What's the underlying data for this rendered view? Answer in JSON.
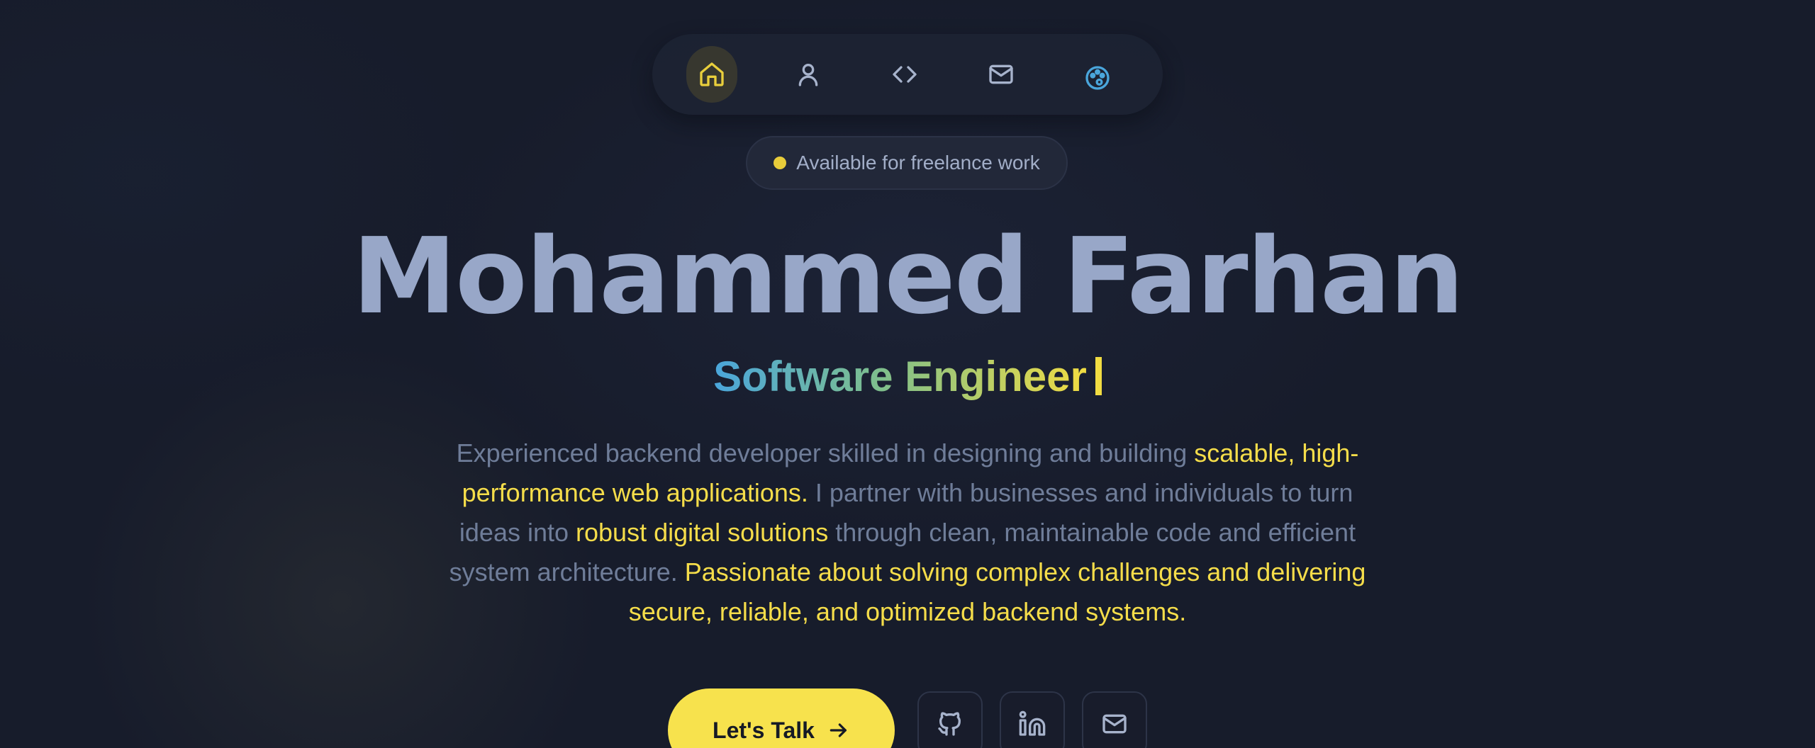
{
  "nav": {
    "items": [
      {
        "icon": "home-icon",
        "active": true
      },
      {
        "icon": "user-icon",
        "active": false
      },
      {
        "icon": "code-icon",
        "active": false
      },
      {
        "icon": "mail-icon",
        "active": false
      },
      {
        "icon": "palette-icon",
        "active": false
      }
    ]
  },
  "badge": {
    "text": "Available for freelance work",
    "dot_color": "#e8cc3a"
  },
  "hero": {
    "name": "Mohammed Farhan",
    "role": "Software Engineer",
    "description": {
      "p1": "Experienced backend developer skilled in designing and building ",
      "h1": "scalable, high-performance web applications.",
      "p2": " I partner with businesses and individuals to turn ideas into ",
      "h2": "robust digital solutions",
      "p3": " through clean, maintainable code and efficient system architecture. ",
      "h3": "Passionate about solving complex challenges and delivering secure, reliable, and optimized backend systems."
    }
  },
  "cta": {
    "label": "Let's Talk",
    "icon": "arrow-right-icon"
  },
  "social": [
    {
      "icon": "github-icon"
    },
    {
      "icon": "linkedin-icon"
    },
    {
      "icon": "mail-icon"
    }
  ],
  "colors": {
    "background": "#171c2b",
    "accent": "#f7e24d",
    "muted_text": "#6f7d99",
    "name": "#98a7c8",
    "palette_icon": "#4aa6dc"
  }
}
